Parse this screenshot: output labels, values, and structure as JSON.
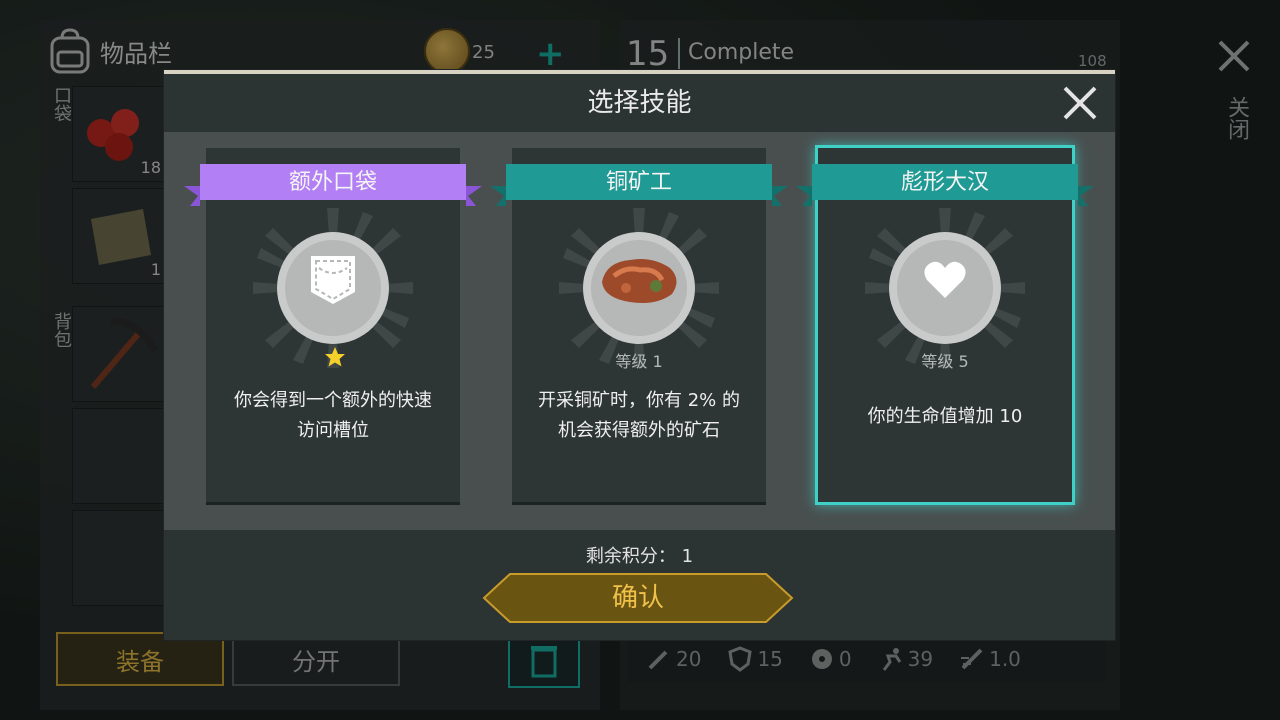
{
  "background": {
    "inventory_title": "物品栏",
    "coins": "25",
    "plus": "+",
    "level": "15",
    "level_status": "Complete",
    "xp": "108",
    "close_label": "关闭",
    "pocket_label": "口袋",
    "backpack_label": "背包",
    "slots": [
      {
        "icon": "berries-icon",
        "count": "18"
      },
      {
        "icon": "cloth-icon",
        "count": "1"
      },
      {
        "icon": "pickaxe-icon",
        "count": ""
      }
    ],
    "equip_button": "装备",
    "split_button": "分开",
    "stats": [
      {
        "icon": "sword-icon",
        "value": "20"
      },
      {
        "icon": "shield-icon",
        "value": "15"
      },
      {
        "icon": "radiation-icon",
        "value": "0"
      },
      {
        "icon": "running-icon",
        "value": "39"
      },
      {
        "icon": "speed-icon",
        "value": "1.0"
      }
    ]
  },
  "modal": {
    "title": "选择技能",
    "remaining_points": "剩余积分： 1",
    "confirm_label": "确认",
    "cards": [
      {
        "title": "额外口袋",
        "ribbon_color": "#b27ff5",
        "ribbon_dark": "#8a55d6",
        "icon": "pocket-icon",
        "level": "",
        "stars": 1,
        "desc_line1": "你会得到一个额外的快速",
        "desc_line2": "访问槽位",
        "selected": false
      },
      {
        "title": "铜矿工",
        "ribbon_color": "#1f9a94",
        "ribbon_dark": "#14706b",
        "icon": "copper-ore-icon",
        "level": "等级 1",
        "stars": 0,
        "desc_line1": "开采铜矿时，你有 2% 的",
        "desc_line2": "机会获得额外的矿石",
        "selected": false
      },
      {
        "title": "彪形大汉",
        "ribbon_color": "#1f9a94",
        "ribbon_dark": "#14706b",
        "icon": "heart-icon",
        "level": "等级 5",
        "stars": 0,
        "desc_line1": "你的生命值增加 10",
        "desc_line2": "",
        "selected": true
      }
    ]
  },
  "colors": {
    "accent_teal": "#1aa89a",
    "gold": "#f0c24a",
    "purple": "#b27ff5"
  }
}
